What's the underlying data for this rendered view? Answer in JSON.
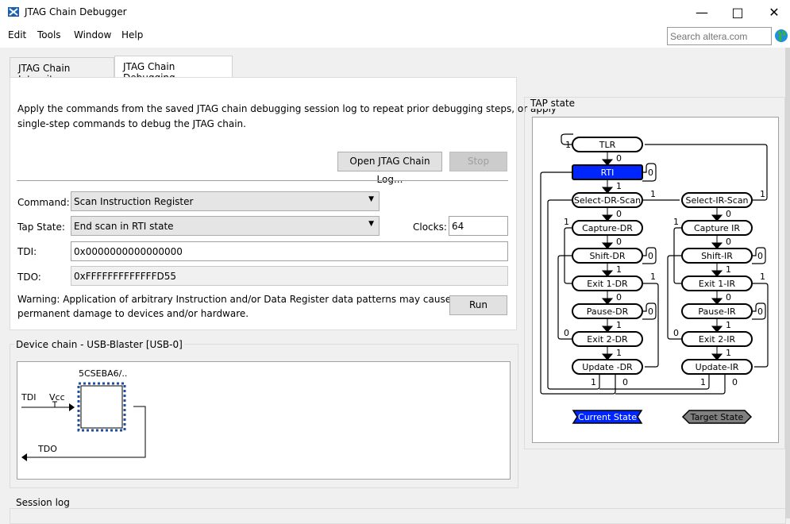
{
  "window": {
    "title": "JTAG Chain Debugger"
  },
  "menu": [
    "Edit",
    "Tools",
    "Window",
    "Help"
  ],
  "search": {
    "placeholder": "Search altera.com"
  },
  "tabs": [
    {
      "label": "JTAG Chain Integrity"
    },
    {
      "label": "JTAG Chain Debugging",
      "active": true
    }
  ],
  "debug": {
    "description": "Apply the commands from the saved JTAG chain debugging session log to repeat prior debugging steps, or apply",
    "description2": "single-step commands to debug the JTAG chain.",
    "open_log": "Open JTAG Chain Log...",
    "stop": "Stop",
    "command_label": "Command:",
    "command_value": "Scan Instruction Register",
    "tap_state_label": "Tap State:",
    "tap_state_value": "End scan in RTI state",
    "clocks_label": "Clocks:",
    "clocks_value": "64",
    "tdi_label": "TDI:",
    "tdi_value": "0x0000000000000000",
    "tdo_label": "TDO:",
    "tdo_value": "0xFFFFFFFFFFFFFD55",
    "warning": "Warning: Application of arbitrary Instruction and/or Data Register data patterns may cause",
    "warning2": "permanent damage to devices and/or hardware.",
    "run": "Run"
  },
  "device_chain": {
    "label": "Device chain - USB-Blaster [USB-0]",
    "device": "5CSEBA6/..",
    "tdi": "TDI",
    "tdo": "TDO",
    "vcc": "Vcc"
  },
  "tap": {
    "label": "TAP state",
    "states": [
      "TLR",
      "RTI",
      "Select-DR-Scan",
      "Capture-DR",
      "Shift-DR",
      "Exit 1-DR",
      "Pause-DR",
      "Exit 2-DR",
      "Update -DR",
      "Select-IR-Scan",
      "Capture IR",
      "Shift-IR",
      "Exit 1-IR",
      "Pause-IR",
      "Exit 2-IR",
      "Update-IR"
    ],
    "current_state": "RTI",
    "transition_labels": [
      "1",
      "0",
      "0",
      "1",
      "1",
      "1",
      "0",
      "0",
      "1",
      "1",
      "0",
      "0",
      "0",
      "0",
      "1",
      "1",
      "1",
      "1",
      "0",
      "0",
      "0",
      "0",
      "1",
      "1",
      "0",
      "0",
      "1",
      "1",
      "1",
      "0",
      "1",
      "0"
    ],
    "legend": {
      "current": "Current State",
      "target": "Target State"
    },
    "colors": {
      "current": "#0026ff",
      "target": "#808080"
    }
  },
  "session_log": {
    "label": "Session log"
  }
}
